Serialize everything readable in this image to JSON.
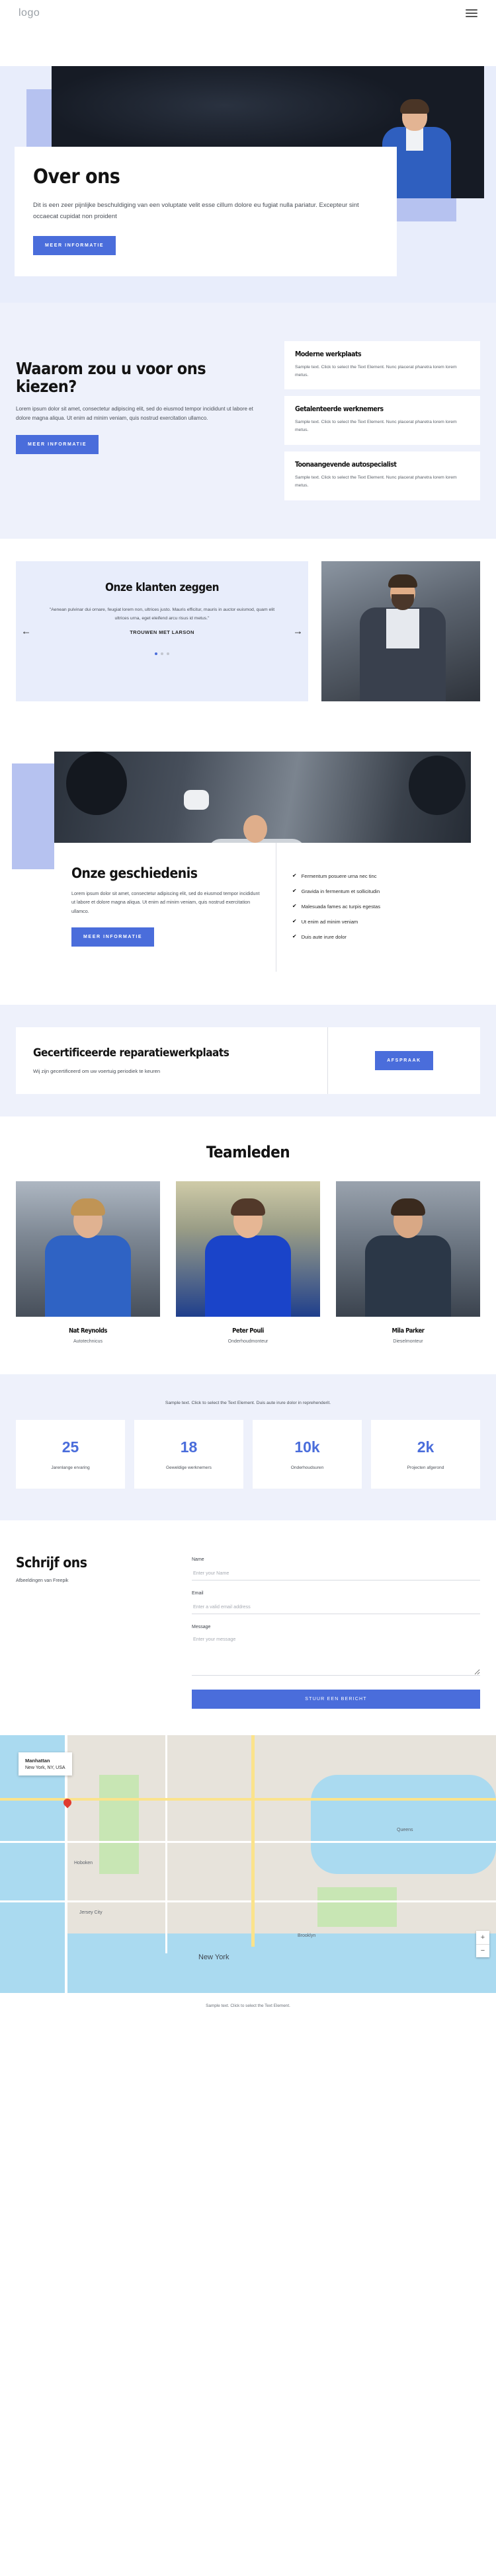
{
  "header": {
    "logo": "logo",
    "menu_icon": "hamburger-icon"
  },
  "about": {
    "title": "Over ons",
    "body": "Dit is een zeer pijnlijke beschuldiging van een voluptate velit esse cillum dolore eu fugiat nulla pariatur. Excepteur sint occaecat cupidat non proident",
    "button": "MEER INFORMATIE"
  },
  "why": {
    "title": "Waarom zou u voor ons kiezen?",
    "body": "Lorem ipsum dolor sit amet, consectetur adipiscing elit, sed do eiusmod tempor incididunt ut labore et dolore magna aliqua. Ut enim ad minim veniam, quis nostrud exercitation ullamco.",
    "button": "MEER INFORMATIE",
    "cards": [
      {
        "title": "Moderne werkplaats",
        "body": "Sample text. Click to select the Text Element. Nunc placerat pharetra lorem lorem metus."
      },
      {
        "title": "Getalenteerde werknemers",
        "body": "Sample text. Click to select the Text Element. Nunc placerat pharetra lorem lorem metus."
      },
      {
        "title": "Toonaangevende autospecialist",
        "body": "Sample text. Click to select the Text Element. Nunc placerat pharetra lorem lorem metus."
      }
    ]
  },
  "testimonials": {
    "title": "Onze klanten zeggen",
    "quote": "\"Aenean pulvinar dui ornare, feugiat lorem non, ultrices justo. Mauris efficitur, mauris in auctor euismod, quam elit ultrices urna, eget eleifend arcu risus id metus.\"",
    "author": "TROUWEN MET LARSON",
    "prev": "←",
    "next": "→"
  },
  "history": {
    "title": "Onze geschiedenis",
    "body": "Lorem ipsum dolor sit amet, consectetur adipiscing elit, sed do eiusmod tempor incididunt ut labore et dolore magna aliqua. Ut enim ad minim veniam, quis nostrud exercitation ullamco.",
    "button": "MEER INFORMATIE",
    "checklist": [
      "Fermentum posuere urna nec tinc",
      "Gravida in fermentum et sollicitudin",
      "Malesuada fames ac turpis egestas",
      "Ut enim ad minim veniam",
      "Duis aute irure dolor"
    ],
    "check_glyph": "✔"
  },
  "certified": {
    "title": "Gecertificeerde reparatiewerkplaats",
    "body": "Wij zijn gecertificeerd om uw voertuig periodiek te keuren",
    "button": "AFSPRAAK"
  },
  "team": {
    "title": "Teamleden",
    "prev": "‹",
    "next": "›",
    "members": [
      {
        "name": "Nat Reynolds",
        "role": "Autotechnicus"
      },
      {
        "name": "Peter Pouli",
        "role": "Onderhoudmonteur"
      },
      {
        "name": "Mila Parker",
        "role": "Dieselmonteur"
      }
    ]
  },
  "stats": {
    "subtitle": "Sample text. Click to select the Text Element. Duis aute irure dolor in reprehenderit.",
    "items": [
      {
        "value": "25",
        "label": "Jarenlange ervaring"
      },
      {
        "value": "18",
        "label": "Geweldige werknemers"
      },
      {
        "value": "10k",
        "label": "Onderhoudsuren"
      },
      {
        "value": "2k",
        "label": "Projecten afgerond"
      }
    ]
  },
  "contact": {
    "title": "Schrijf ons",
    "subtitle": "Afbeeldingen van Freepik",
    "name_label": "Name",
    "name_placeholder": "Enter your Name",
    "email_label": "Email",
    "email_placeholder": "Enter a valid email address",
    "message_label": "Message",
    "message_placeholder": "Enter your message",
    "submit": "STUUR EEN BERICHT"
  },
  "map": {
    "popup_title": "Manhattan",
    "popup_line": "New York, NY, USA",
    "city": "New York",
    "labels": [
      "Hoboken",
      "Jersey City",
      "Brooklyn",
      "Queens"
    ],
    "zoom_in": "+",
    "zoom_out": "−"
  },
  "footer": {
    "text": "Sample text. Click to select the Text Element."
  },
  "colors": {
    "accent": "#4a6ddb",
    "band": "#b6c2f0",
    "tint": "#eef1fb"
  }
}
